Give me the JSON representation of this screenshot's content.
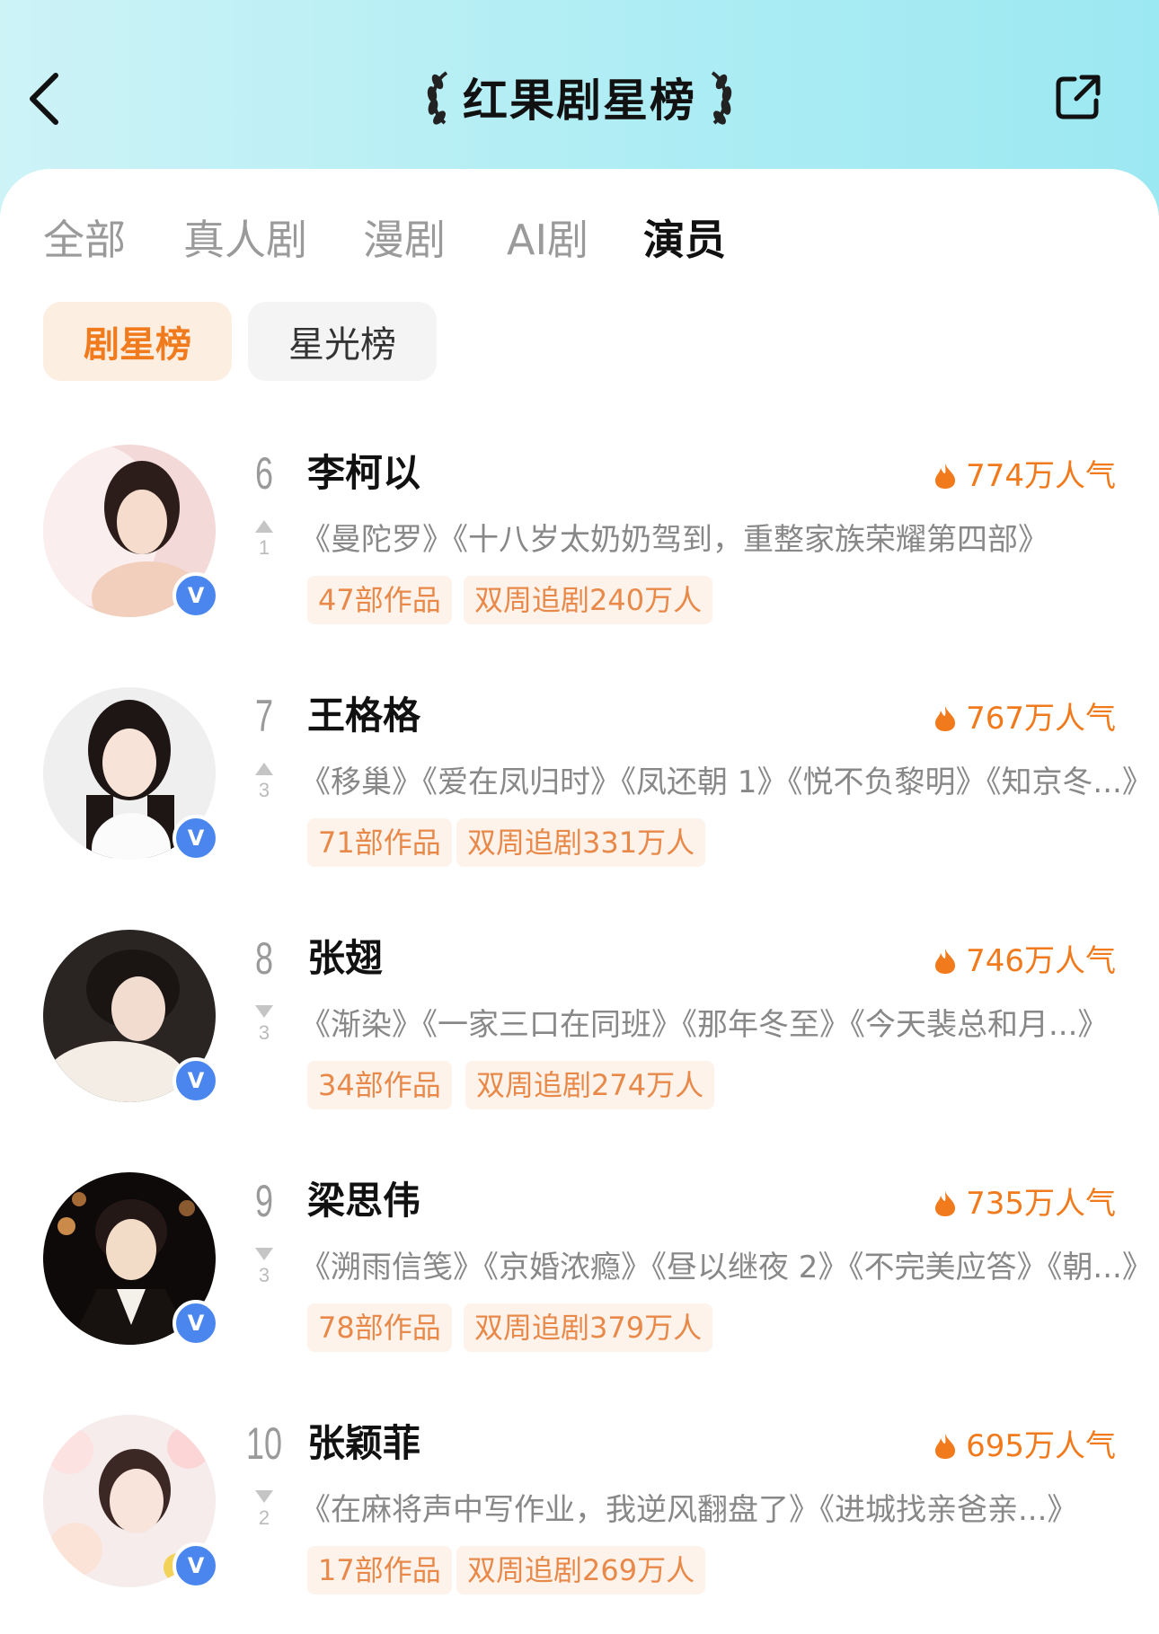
{
  "header": {
    "title": "红果剧星榜"
  },
  "tabs": [
    {
      "label": "全部"
    },
    {
      "label": "真人剧"
    },
    {
      "label": "漫剧"
    },
    {
      "label": "AI剧"
    },
    {
      "label": "演员"
    }
  ],
  "subtabs": [
    {
      "label": "剧星榜"
    },
    {
      "label": "星光榜"
    }
  ],
  "list": [
    {
      "rank": "6",
      "name": "李柯以",
      "popularity": "774万人气",
      "trend": "up",
      "trend_value": "1",
      "works": "《曼陀罗》《十八岁太奶奶驾到，重整家族荣耀第四部》",
      "tag_works": "47部作品",
      "tag_follow": "双周追剧240万人"
    },
    {
      "rank": "7",
      "name": "王格格",
      "popularity": "767万人气",
      "trend": "up",
      "trend_value": "3",
      "works": "《移巢》《爱在凤归时》《凤还朝 1》《悦不负黎明》《知京冬...》",
      "tag_works": "71部作品",
      "tag_follow": "双周追剧331万人"
    },
    {
      "rank": "8",
      "name": "张翅",
      "popularity": "746万人气",
      "trend": "down",
      "trend_value": "3",
      "works": "《渐染》《一家三口在同班》《那年冬至》《今天裴总和月...》",
      "tag_works": "34部作品",
      "tag_follow": "双周追剧274万人"
    },
    {
      "rank": "9",
      "name": "梁思伟",
      "popularity": "735万人气",
      "trend": "down",
      "trend_value": "3",
      "works": "《溯雨信笺》《京婚浓瘾》《昼以继夜 2》《不完美应答》《朝...》",
      "tag_works": "78部作品",
      "tag_follow": "双周追剧379万人"
    },
    {
      "rank": "10",
      "name": "张颖菲",
      "popularity": "695万人气",
      "trend": "down",
      "trend_value": "2",
      "works": "《在麻将声中写作业，我逆风翻盘了》《进城找亲爸亲...》",
      "tag_works": "17部作品",
      "tag_follow": "双周追剧269万人"
    }
  ],
  "badge": "V",
  "colors": {
    "accent": "#f07a1c",
    "verified": "#4b86ef",
    "header_bg": "#b3eef4"
  }
}
